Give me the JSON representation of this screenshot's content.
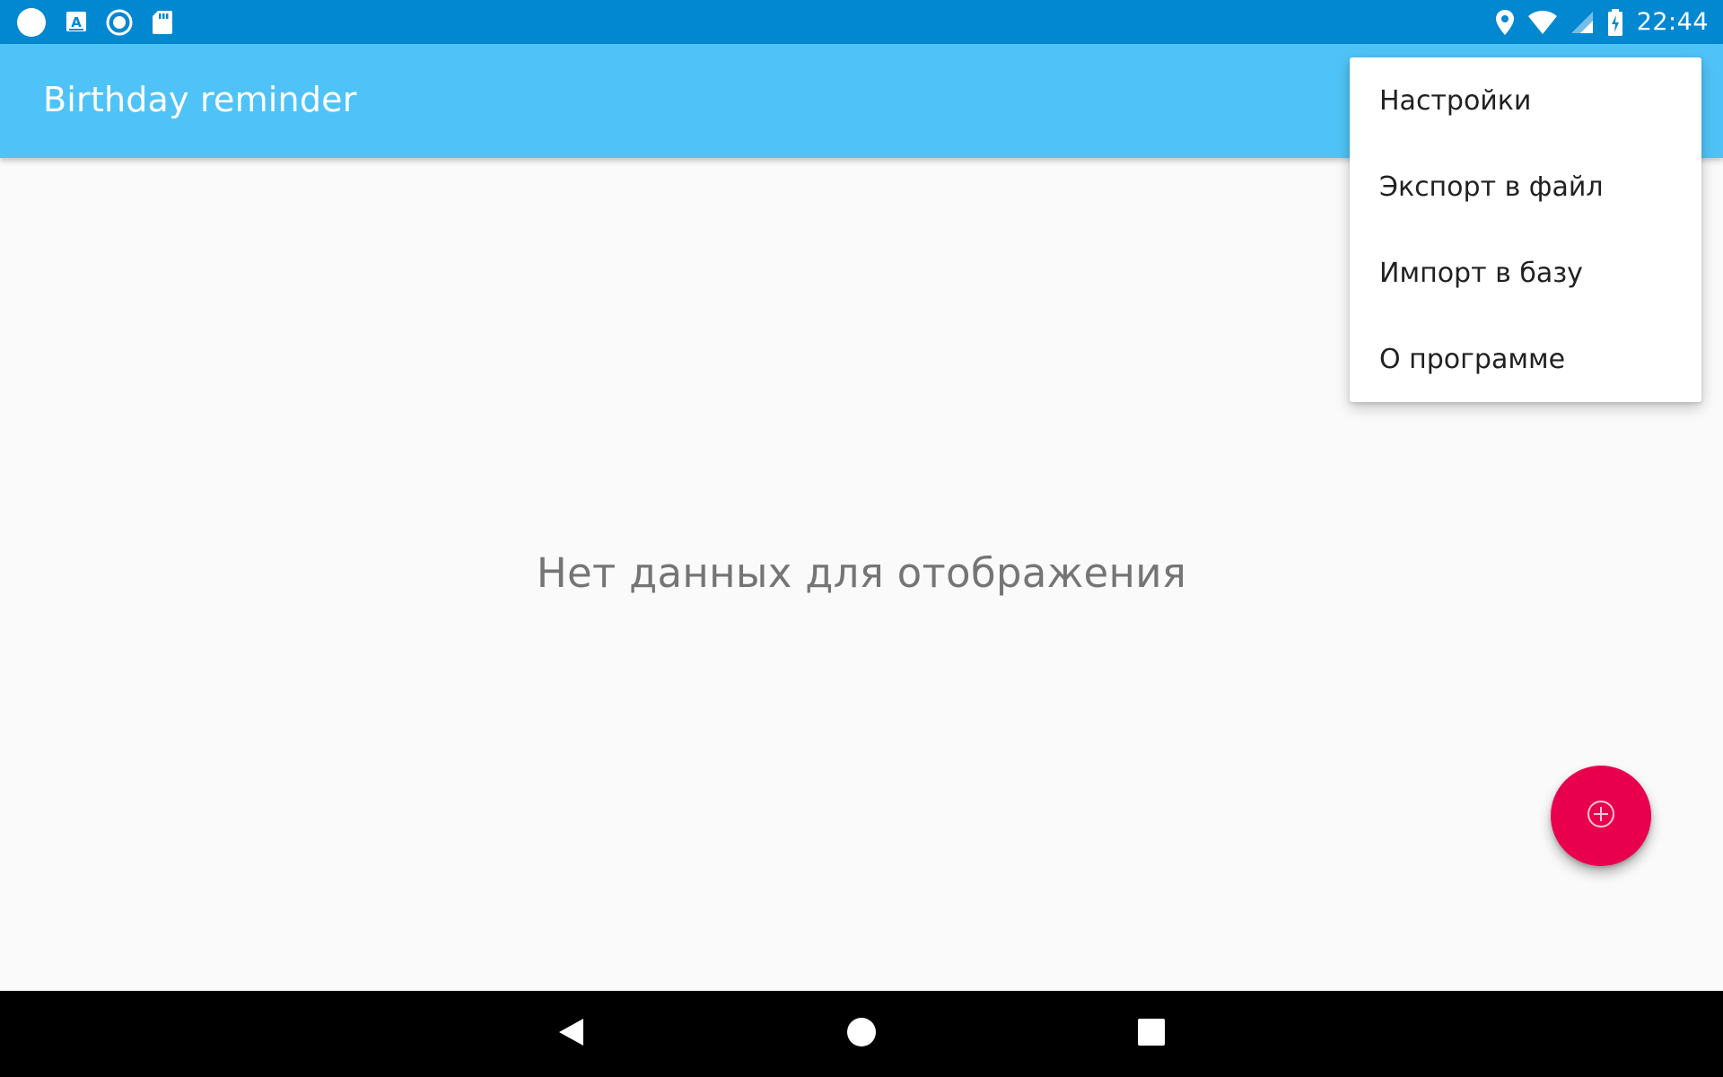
{
  "status_bar": {
    "time": "22:44",
    "left_icons": [
      "circle-notification-icon",
      "keyboard-a-icon",
      "radio-button-icon",
      "sd-card-icon"
    ],
    "right_icons": [
      "location-icon",
      "wifi-icon",
      "cell-signal-icon",
      "battery-charging-icon"
    ]
  },
  "app_bar": {
    "title": "Birthday reminder"
  },
  "main": {
    "empty_message": "Нет данных для отображения"
  },
  "overflow_menu": {
    "items": [
      {
        "label": "Настройки"
      },
      {
        "label": "Экспорт в файл"
      },
      {
        "label": "Импорт в базу"
      },
      {
        "label": "О программе"
      }
    ]
  },
  "fab": {
    "icon": "add-circle-icon"
  },
  "nav_bar": {
    "buttons": [
      "back-icon",
      "home-icon",
      "recents-icon"
    ]
  },
  "colors": {
    "status_bar": "#0288d1",
    "app_bar": "#4fc3f7",
    "fab": "#e8004f",
    "background": "#fafafa"
  }
}
